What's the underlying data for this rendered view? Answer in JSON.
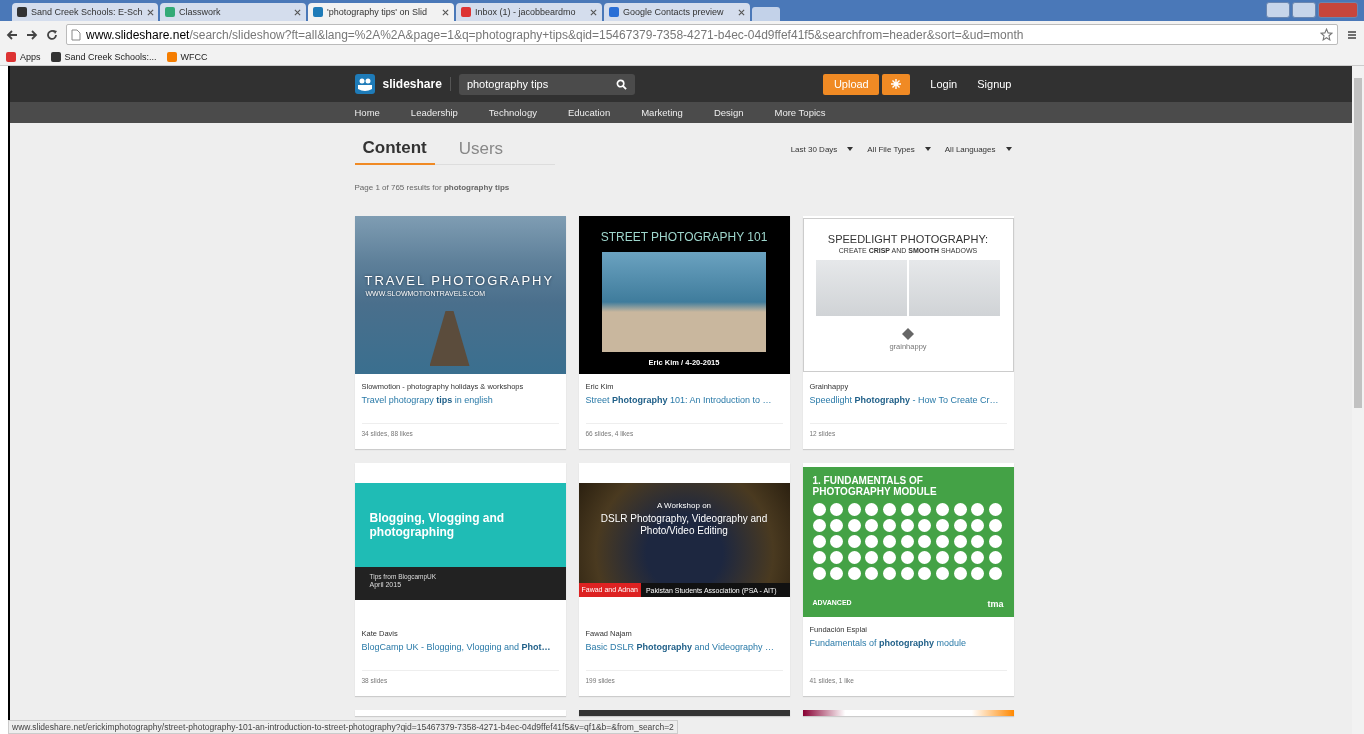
{
  "browser": {
    "tabs": [
      {
        "label": "Sand Creek Schools: E-Sch",
        "selected": false
      },
      {
        "label": "Classwork",
        "selected": false
      },
      {
        "label": "'photography tips' on Slid",
        "selected": true
      },
      {
        "label": "Inbox (1) - jacobbeardmo",
        "selected": false
      },
      {
        "label": "Google Contacts preview",
        "selected": false
      }
    ],
    "address": {
      "host": "www.slideshare.net",
      "path": "/search/slideshow?ft=all&lang=%2A%2A&page=1&q=photography+tips&qid=15467379-7358-4271-b4ec-04d9ffef41f5&searchfrom=header&sort=&ud=month"
    },
    "bookmarks": [
      {
        "label": "Apps"
      },
      {
        "label": "Sand Creek Schools:..."
      },
      {
        "label": "WFCC"
      }
    ],
    "status_url": "www.slideshare.net/erickimphotography/street-photography-101-an-introduction-to-street-photography?qid=15467379-7358-4271-b4ec-04d9ffef41f5&v=qf1&b=&from_search=2"
  },
  "header": {
    "brand": "slideshare",
    "search": {
      "value": "photography tips"
    },
    "upload": "Upload",
    "login": "Login",
    "signup": "Signup"
  },
  "nav": [
    "Home",
    "Leadership",
    "Technology",
    "Education",
    "Marketing",
    "Design",
    "More Topics"
  ],
  "result_tabs": [
    {
      "label": "Content",
      "selected": true
    },
    {
      "label": "Users",
      "selected": false
    }
  ],
  "filters": [
    "Last 30 Days",
    "All File Types",
    "All Languages"
  ],
  "summary": "Page 1 of 765 results for **photography tips**",
  "cards": [
    {
      "thumb": {
        "kind": "travel",
        "title": "TRAVEL PHOTOGRAPHY",
        "subtitle": "WWW.SLOWMOTIONTRAVELS.COM"
      },
      "author": "Slowmotion - photography holidays & workshops",
      "title": "Travel photograpy **tips** in english",
      "stats": "34 slides, 88 likes"
    },
    {
      "thumb": {
        "kind": "street",
        "title": "STREET PHOTOGRAPHY 101",
        "caption": "Eric Kim / 4-20-2015"
      },
      "author": "Eric Kim",
      "title": "Street **Photography** 101: An Introduction to …",
      "stats": "66 slides, 4 likes"
    },
    {
      "thumb": {
        "kind": "speedlight",
        "title": "SPEEDLIGHT PHOTOGRAPHY:",
        "subtitle": "CREATE **CRISP** AND **SMOOTH** SHADOWS",
        "caption": "grainhappy"
      },
      "author": "Grainhappy",
      "title": "Speedlight **Photography** - How To Create Cr…",
      "stats": "12 slides"
    },
    {
      "thumb": {
        "kind": "teal",
        "title": "Blogging, Vlogging and photographing",
        "subtitle": "Tips from BlogcampUK",
        "caption": "April 2015"
      },
      "author": "Kate Davis",
      "title": "BlogCamp UK - Blogging, Vlogging and **Phot…**",
      "stats": "38 slides"
    },
    {
      "thumb": {
        "kind": "dslr",
        "title": "A Workshop on",
        "subtitle": "DSLR Photography, Videography and Photo/Video Editing",
        "caption": "Fawad and Adnan",
        "note": "Pakistan Students Association (PSA - AIT)"
      },
      "author": "Fawad Najam",
      "title": "Basic DSLR **Photography** and Videography …",
      "stats": "199 slides"
    },
    {
      "thumb": {
        "kind": "green",
        "title": "1. FUNDAMENTALS OF PHOTOGRAPHY MODULE",
        "subtitle": "ADVANCED",
        "caption": "tma"
      },
      "author": "Fundación Esplai",
      "title": "Fundamentals of **photography** module",
      "stats": "41 slides, 1 like"
    }
  ]
}
